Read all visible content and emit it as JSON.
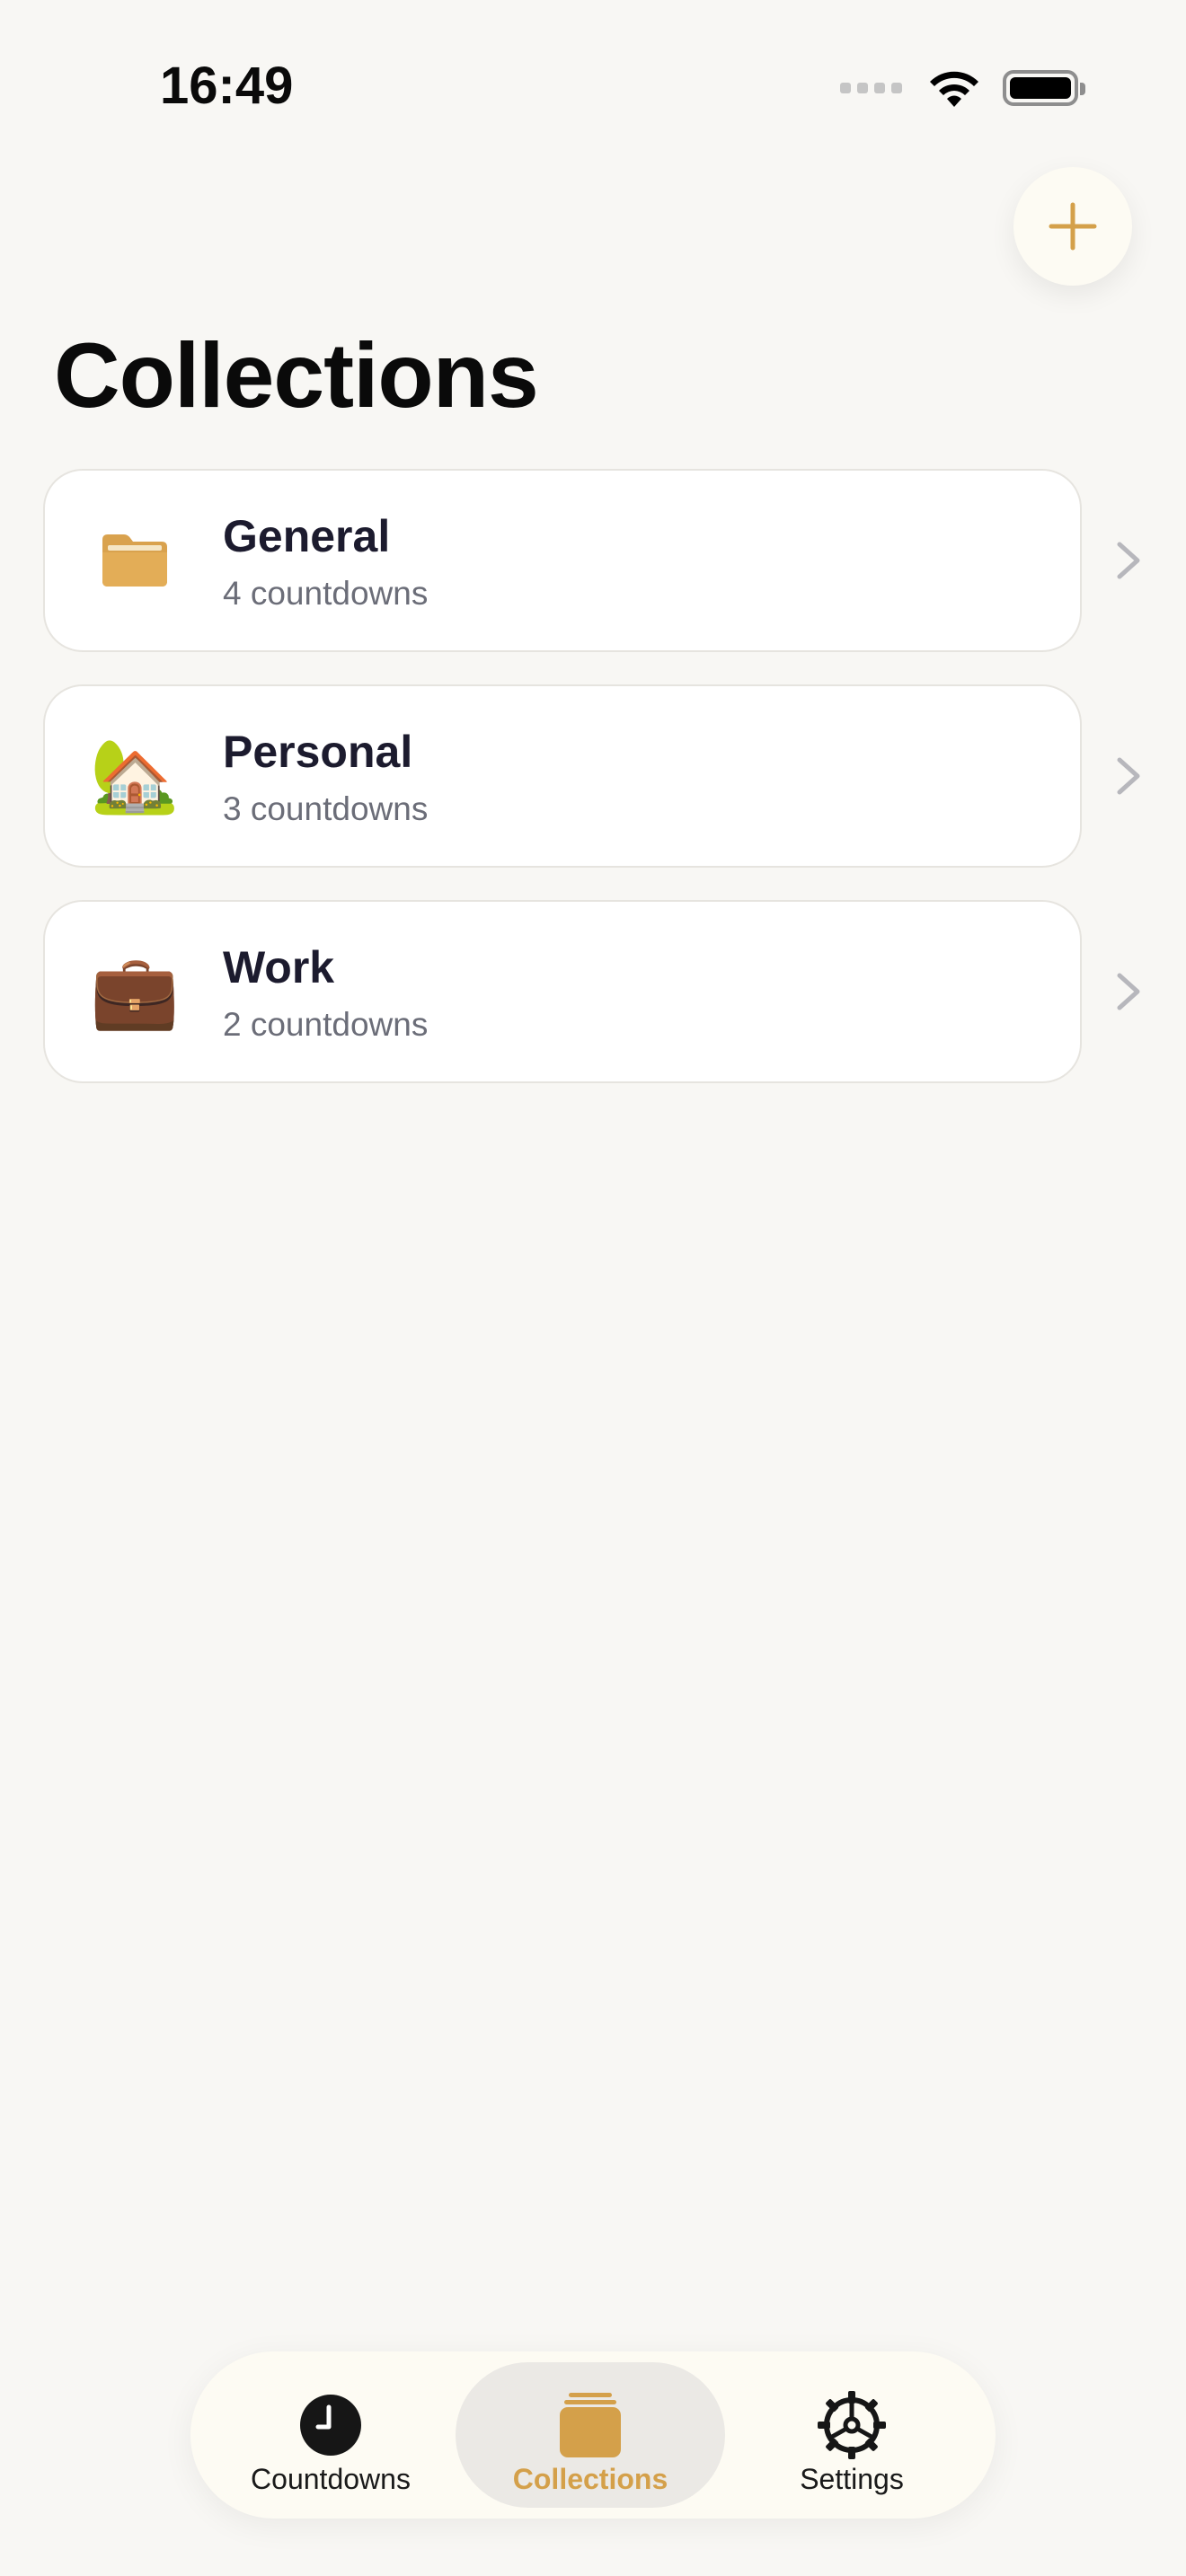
{
  "status_bar": {
    "time": "16:49"
  },
  "header": {
    "add_button_icon": "plus-icon",
    "title": "Collections"
  },
  "collections": [
    {
      "name": "General",
      "count_text": "4 countdowns",
      "icon": "folder-icon"
    },
    {
      "name": "Personal",
      "count_text": "3 countdowns",
      "icon": "house-with-garden-icon"
    },
    {
      "name": "Work",
      "count_text": "2 countdowns",
      "icon": "briefcase-icon"
    }
  ],
  "tab_bar": {
    "tabs": [
      {
        "label": "Countdowns",
        "icon": "clock-icon",
        "active": false
      },
      {
        "label": "Collections",
        "icon": "stack-icon",
        "active": true
      },
      {
        "label": "Settings",
        "icon": "gear-icon",
        "active": false
      }
    ]
  },
  "colors": {
    "accent": "#d4a04a",
    "background": "#f8f7f4",
    "card": "#ffffff",
    "title_text": "#1c1b2e",
    "secondary_text": "#6b6d78"
  }
}
